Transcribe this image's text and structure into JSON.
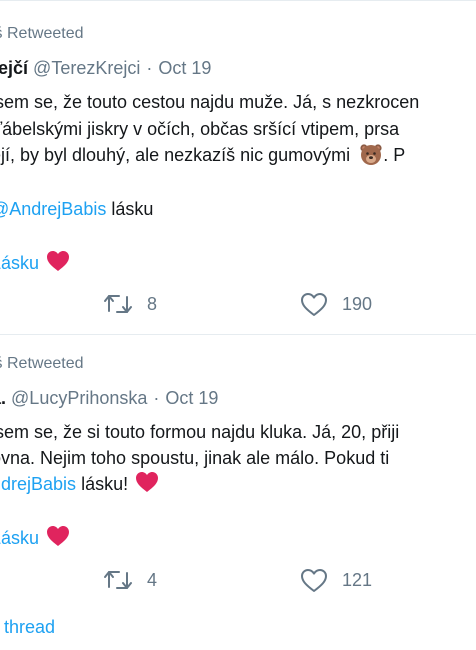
{
  "tweets": [
    {
      "retweet_label": "iš Retweeted",
      "author_name": "rejčí",
      "author_handle": "@TerezKrejci",
      "separator": "·",
      "date": "Oct 19",
      "text_lines": [
        "jsem se, že touto cestou najdu muže. Já, s nezkrocen",
        "ďábelskými jiskry v očích, občas sršící vtipem, prsa",
        "ejí, by byl dlouhý, ale nezkazíš nic gumovými",
        "@AndrejBabis lásku",
        "Lásku"
      ],
      "line3_after_emoji": ". P",
      "mention": "@AndrejBabis",
      "mention_after": " lásku",
      "retweet_count": "8",
      "like_count": "190"
    },
    {
      "retweet_label": "iš Retweeted",
      "author_name": "a.",
      "author_handle": "@LucyPrihonska",
      "separator": "·",
      "date": "Oct 19",
      "text_lines": [
        "jsem se, že si touto formou najdu kluka. Já, 20, přiji",
        "ovna. Nejim toho spoustu, jinak ale málo. Pokud ti",
        "ndrejBabis",
        "Lásku"
      ],
      "mention_after": " lásku!",
      "retweet_count": "4",
      "like_count": "121"
    }
  ],
  "show_thread_label": "s thread",
  "colors": {
    "link": "#1da1f2",
    "muted": "#657786",
    "heart": "#e0245e",
    "border": "#e6ecf0"
  }
}
